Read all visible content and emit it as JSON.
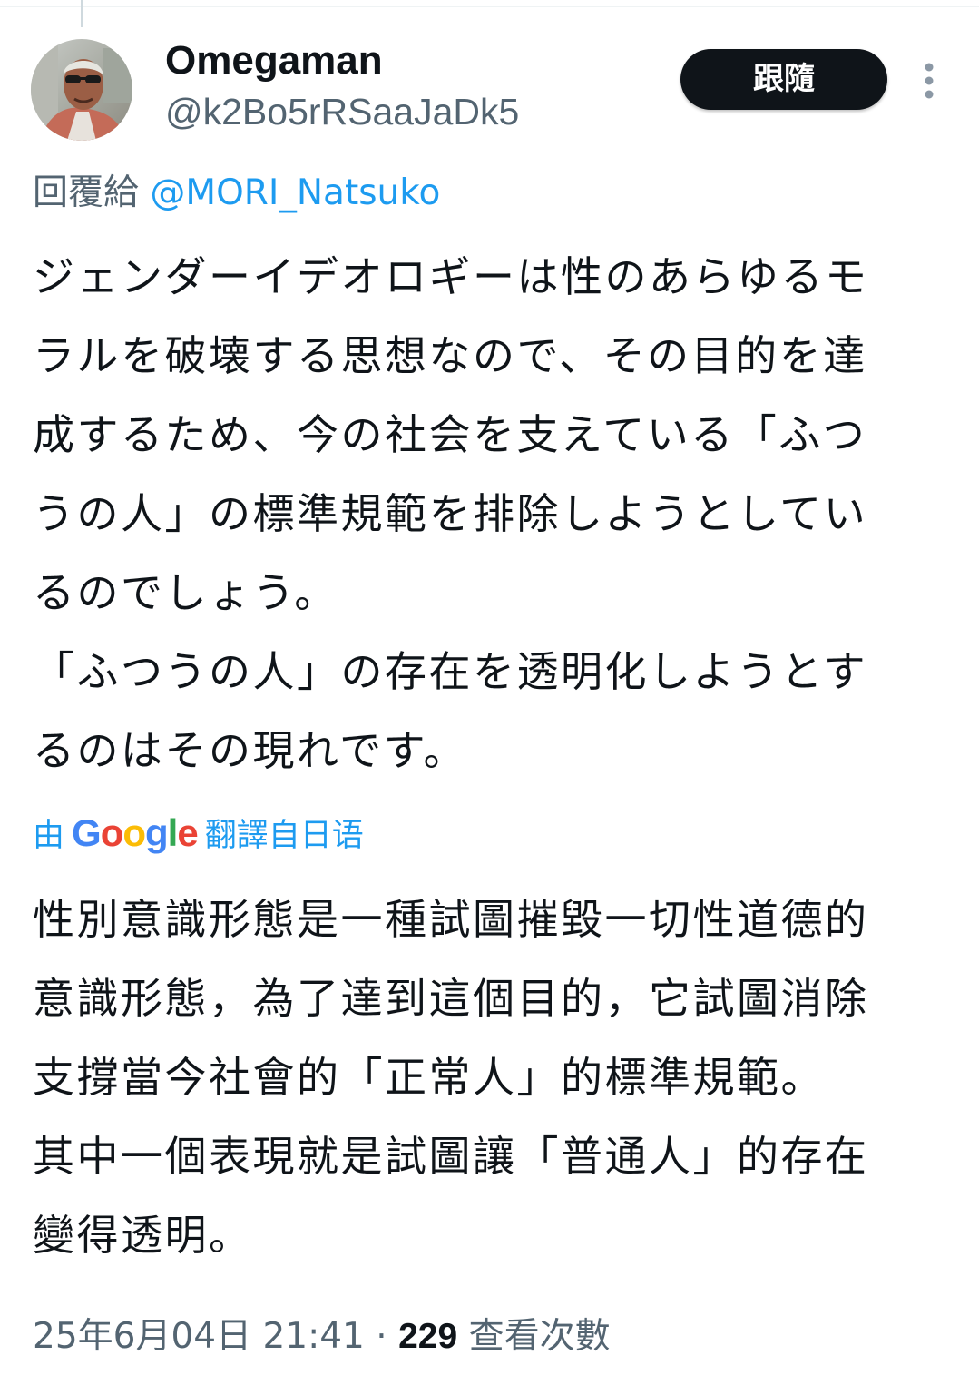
{
  "author": {
    "display_name": "Omegaman",
    "handle": "@k2Bo5rRSaaJaDk5",
    "avatar_icon": "profile-photo"
  },
  "follow_button": {
    "label": "跟隨"
  },
  "more_icon": "more-vertical-icon",
  "reply_context": {
    "label": "回覆給",
    "mention": "@MORI_Natsuko"
  },
  "tweet": {
    "lines": [
      "ジェンダーイデオロギーは性のあらゆるモ",
      "ラルを破壊する思想なので、その目的を達",
      "成するため、今の社会を支えている「ふつ",
      "うの人」の標準規範を排除しようとしてい",
      "るのでしょう。",
      "「ふつうの人」の存在を透明化しようとす",
      "るのはその現れです。"
    ]
  },
  "translation": {
    "prefix": "由",
    "provider": "Google",
    "suffix": "翻譯自日语",
    "lines": [
      "性別意識形態是一種試圖摧毀一切性道德的",
      "意識形態，為了達到這個目的，它試圖消除",
      "支撐當今社會的「正常人」的標準規範。",
      "其中一個表現就是試圖讓「普通人」的存在",
      "變得透明。"
    ]
  },
  "meta": {
    "timestamp": "25年6月04日 21:41",
    "separator": "·",
    "views_count": "229",
    "views_label": "查看次數"
  },
  "colors": {
    "text": "#0f1419",
    "secondary": "#536471",
    "link": "#1d9bf0",
    "button_bg": "#0f1419",
    "button_text": "#ffffff"
  }
}
